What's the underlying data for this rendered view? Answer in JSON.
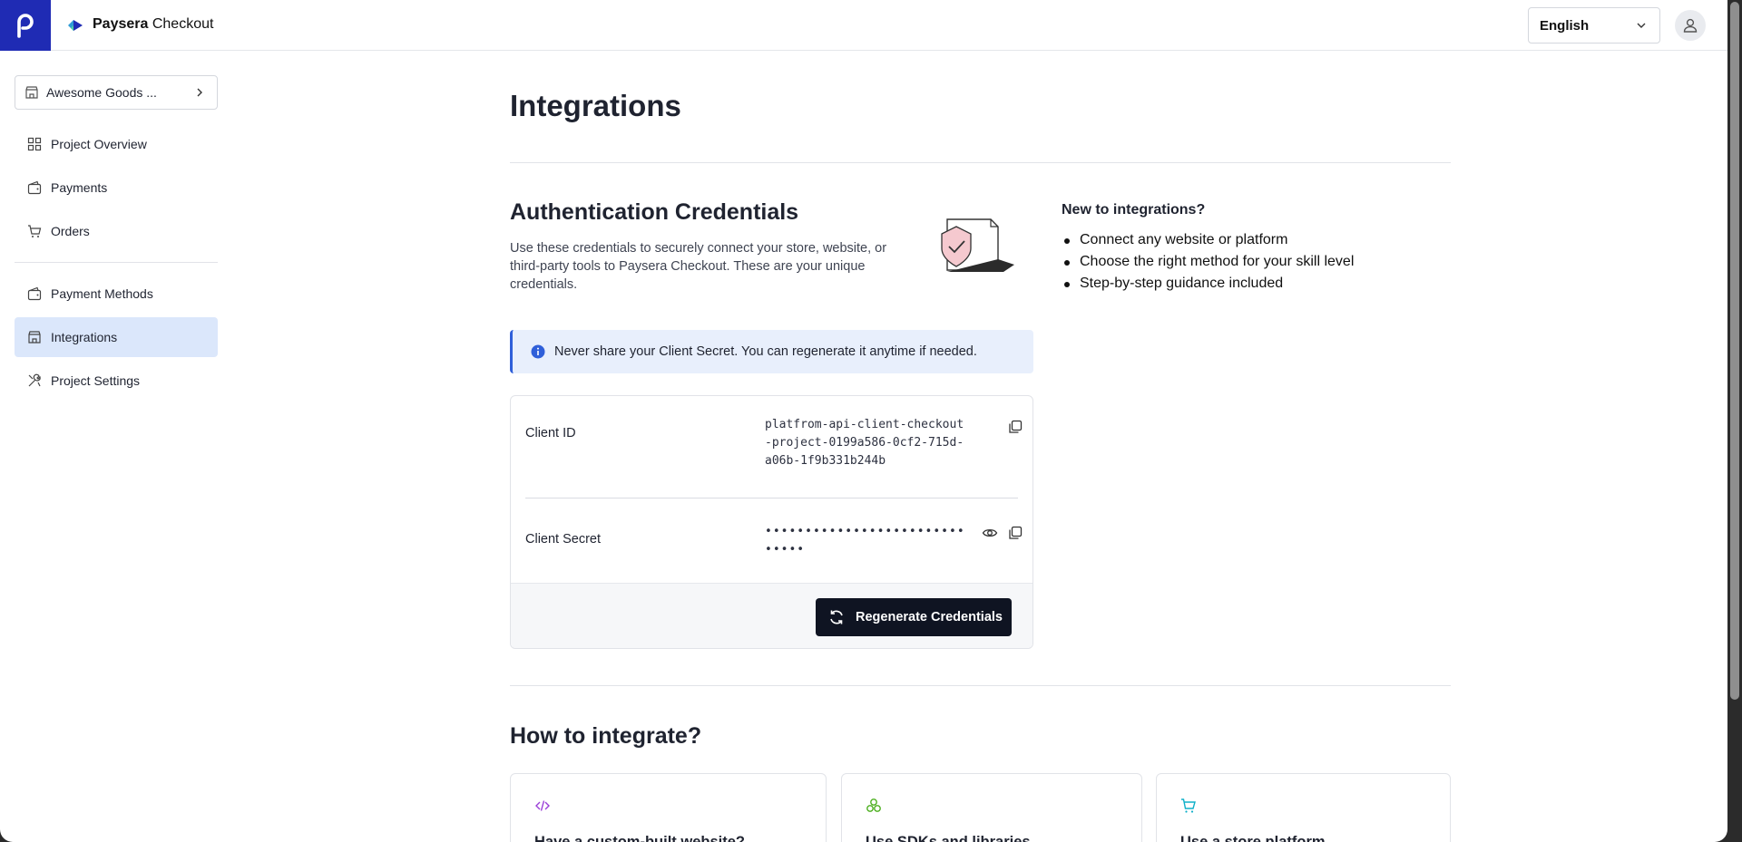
{
  "header": {
    "brand_bold": "Paysera",
    "brand_rest": " Checkout",
    "language": "English"
  },
  "sidebar": {
    "project": "Awesome Goods ...",
    "items": [
      {
        "label": "Project Overview"
      },
      {
        "label": "Payments"
      },
      {
        "label": "Orders"
      },
      {
        "label": "Payment Methods"
      },
      {
        "label": "Integrations"
      },
      {
        "label": "Project Settings"
      }
    ]
  },
  "main": {
    "title": "Integrations",
    "auth": {
      "title": "Authentication Credentials",
      "description": "Use these credentials to securely connect your store, website, or third-party tools to Paysera Checkout. These are your unique credentials.",
      "notice": "Never share your Client Secret. You can regenerate it anytime if needed.",
      "client_id_label": "Client ID",
      "client_id_value": "platfrom-api-client-checkout-project-0199a586-0cf2-715d-a06b-1f9b331b244b",
      "client_secret_label": "Client Secret",
      "client_secret_value": "••••••••••••••••••••••••••••••",
      "regenerate_label": "Regenerate Credentials"
    },
    "help": {
      "title": "New to integrations?",
      "items": [
        "Connect any website or platform",
        "Choose the right method for your skill level",
        "Step-by-step guidance included"
      ]
    },
    "how": {
      "title": "How to integrate?",
      "cards": [
        {
          "title": "Have a custom-built website?",
          "icon": "code-icon",
          "color": "#9b3fd8"
        },
        {
          "title": "Use SDKs and libraries",
          "icon": "packages-icon",
          "color": "#4caf1f"
        },
        {
          "title": "Use a store platform",
          "icon": "cart-icon",
          "color": "#0fb0c9"
        }
      ]
    }
  },
  "colors": {
    "brand": "#1f2bb4",
    "active_nav": "#dbe7fb",
    "notice_bg": "#e8effc",
    "button_dark": "#0f1422"
  }
}
